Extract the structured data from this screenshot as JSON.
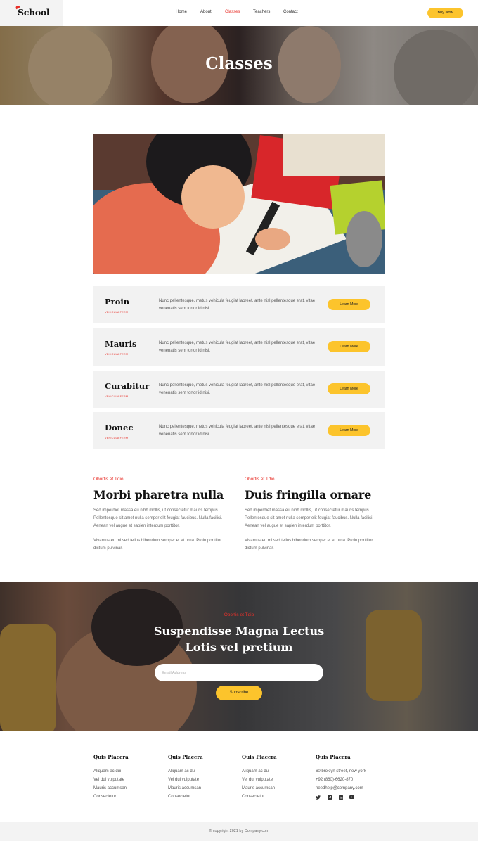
{
  "brand": {
    "logo_text": "School",
    "accent": "#e8312a",
    "button_color": "#fcc42c"
  },
  "nav": {
    "items": [
      {
        "label": "Home"
      },
      {
        "label": "About"
      },
      {
        "label": "Classes",
        "active": true
      },
      {
        "label": "Teachers"
      },
      {
        "label": "Contact"
      }
    ],
    "buy_label": "Buy Now"
  },
  "hero": {
    "title": "Classes"
  },
  "classes": [
    {
      "title": "Proin",
      "subtitle": "VEHICULA FERM",
      "description": "Nunc pellentesque, metus vehicula feugiat laoreet, ante nisl pellentesque erat, vitae venenatis sem tortor id nisi.",
      "button": "Learn More"
    },
    {
      "title": "Mauris",
      "subtitle": "VEHICULA FERM",
      "description": "Nunc pellentesque, metus vehicula feugiat laoreet, ante nisl pellentesque erat, vitae venenatis sem tortor id nisi.",
      "button": "Learn More"
    },
    {
      "title": "Curabitur",
      "subtitle": "VEHICULA FERM",
      "description": "Nunc pellentesque, metus vehicula feugiat laoreet, ante nisl pellentesque erat, vitae venenatis sem tortor id nisi.",
      "button": "Learn More"
    },
    {
      "title": "Donec",
      "subtitle": "VEHICULA FERM",
      "description": "Nunc pellentesque, metus vehicula feugiat laoreet, ante nisl pellentesque erat, vitae venenatis sem tortor id nisi.",
      "button": "Learn More"
    }
  ],
  "info": [
    {
      "eyebrow": "Obortis et Tdio",
      "title": "Morbi pharetra nulla",
      "p1": "Sed imperdiet massa eu nibh mollis, ut consectetur mauris tempus. Pellentesque sit amet nulla semper elit feugiat faucibus. Nulla facilisi. Aenean vel augue et sapien interdum porttitor.",
      "p2": "Vivamus eu mi sed tellus bibendum semper et et urna. Proin porttitor dictum pulvinar."
    },
    {
      "eyebrow": "Obortis et Tdio",
      "title": "Duis fringilla ornare",
      "p1": "Sed imperdiet massa eu nibh mollis, ut consectetur mauris tempus. Pellentesque sit amet nulla semper elit feugiat faucibus. Nulla facilisi. Aenean vel augue et sapien interdum porttitor.",
      "p2": "Vivamus eu mi sed tellus bibendum semper et et urna. Proin porttitor dictum pulvinar."
    }
  ],
  "subscribe": {
    "eyebrow": "Obortis et Tdio",
    "title_line1": "Suspendisse Magna Lectus",
    "title_line2": "Lotis vel pretium",
    "email_placeholder": "Email Address",
    "button": "Subscribe"
  },
  "footer": {
    "columns": [
      {
        "heading": "Quis Placera",
        "items": [
          "Aliquam ac dui",
          "Vel dui vulputate",
          "Mauris accumsan",
          "Consectetur"
        ]
      },
      {
        "heading": "Quis Placera",
        "items": [
          "Aliquam ac dui",
          "Vel dui vulputate",
          "Mauris accumsan",
          "Consectetur"
        ]
      },
      {
        "heading": "Quis Placera",
        "items": [
          "Aliquam ac dui",
          "Vel dui vulputate",
          "Mauris accumsan",
          "Consectetur"
        ]
      },
      {
        "heading": "Quis Placera",
        "items": [
          "60 broklyn street, new york",
          "+92 (860)-6620-870",
          "needhelp@company.com"
        ]
      }
    ],
    "social_icons": [
      "twitter-icon",
      "facebook-icon",
      "linkedin-icon",
      "youtube-icon"
    ],
    "copyright": "© copyright 2021 by Company.com"
  }
}
